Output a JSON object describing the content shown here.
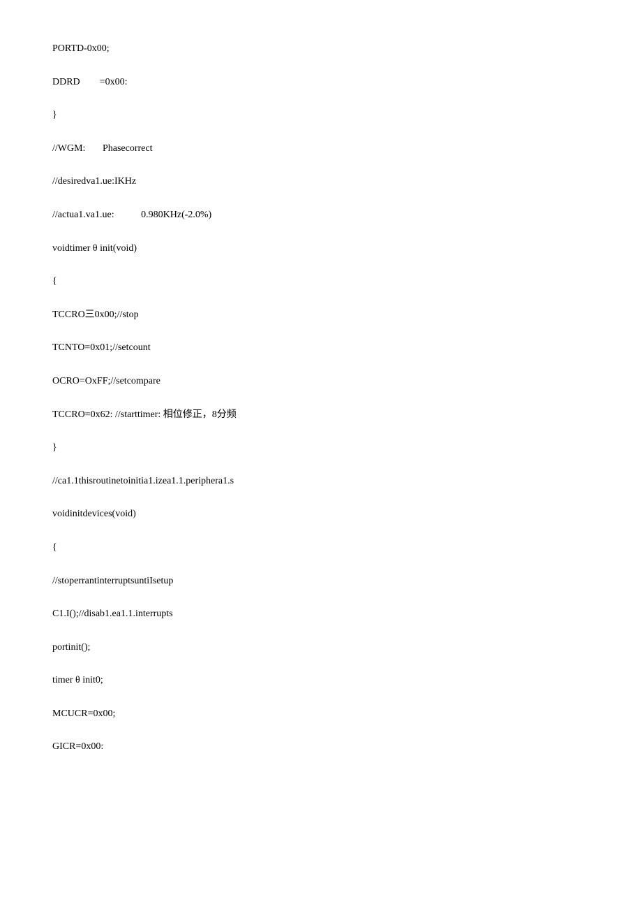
{
  "lines": [
    "PORTD-0x00;",
    "DDRD        =0x00:",
    "}",
    "//WGM:       Phasecorrect",
    "//desiredva1.ue:IKHz",
    "//actua1.va1.ue:           0.980KHz(-2.0%)",
    "voidtimer θ init(void)",
    "{",
    "TCCRO三0x00;//stop",
    "TCNTO=0x01;//setcount",
    "OCRO=OxFF;//setcompare",
    "TCCRO=0x62: //starttimer: 相位修正，8分频",
    "}",
    "//ca1.1thisroutinetoinitia1.izea1.1.periphera1.s",
    "voidinitdevices(void)",
    "{",
    "//stoperrantinterruptsuntiIsetup",
    "C1.I();//disab1.ea1.1.interrupts",
    "portinit();",
    "timer θ init0;",
    "MCUCR=0x00;",
    "GICR=0x00:"
  ]
}
